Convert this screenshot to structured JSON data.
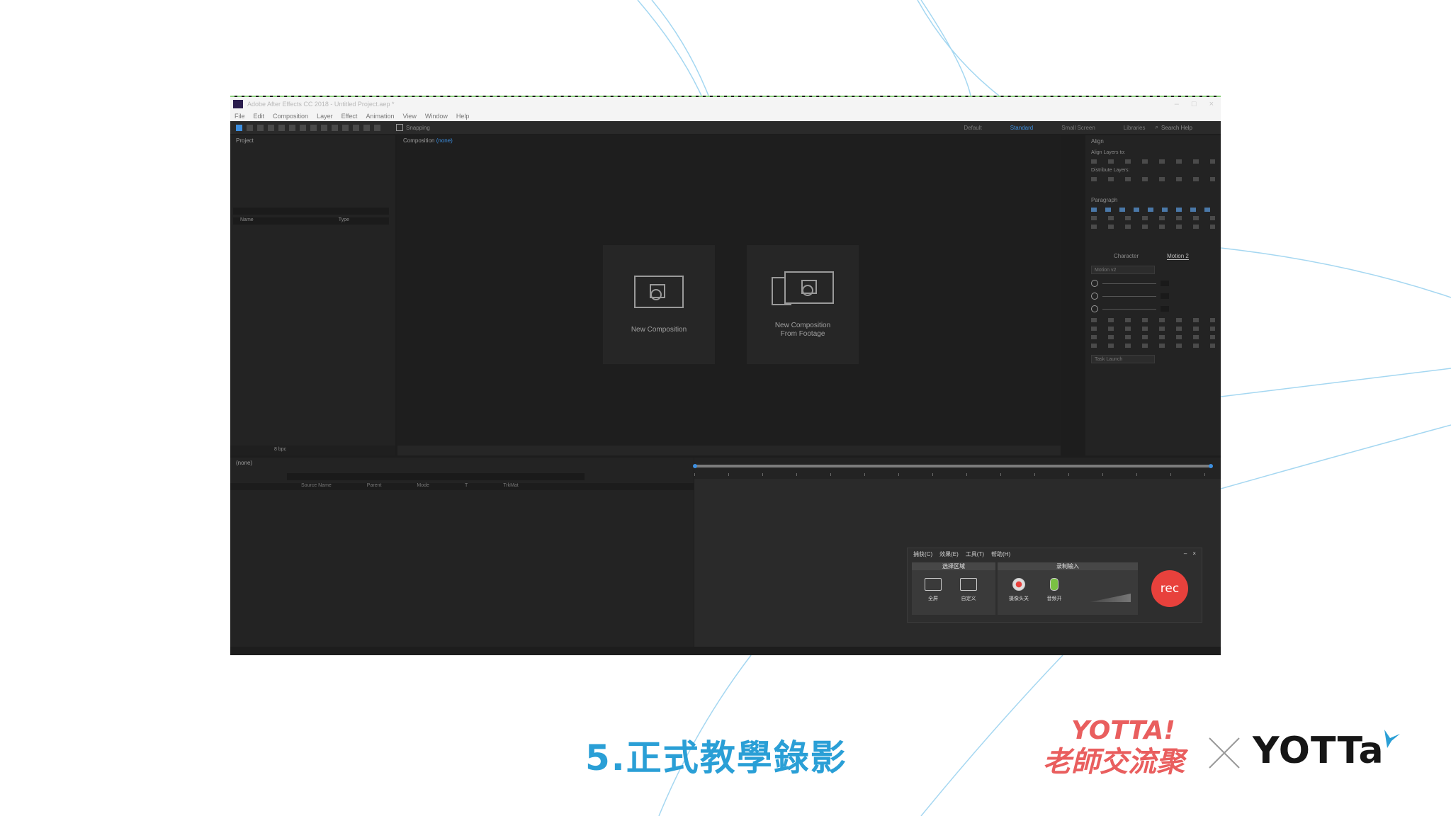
{
  "window": {
    "title": "Adobe After Effects CC 2018 - Untitled Project.aep *",
    "controls": [
      "–",
      "□",
      "×"
    ]
  },
  "menu": [
    "File",
    "Edit",
    "Composition",
    "Layer",
    "Effect",
    "Animation",
    "View",
    "Window",
    "Help"
  ],
  "toolbar": {
    "snapping_label": "Snapping",
    "workspaces": [
      "Default",
      "Standard",
      "Small Screen",
      "Libraries"
    ],
    "active_workspace": "Standard",
    "search_help": "Search Help"
  },
  "project_panel": {
    "title": "Project",
    "columns": [
      "Name",
      "Type"
    ],
    "bpc": "8 bpc"
  },
  "composition_panel": {
    "label": "Composition",
    "comp_name": "(none)",
    "cards": [
      {
        "label": "New Composition"
      },
      {
        "label": "New Composition From Footage"
      }
    ]
  },
  "right_panel": {
    "align_title": "Align",
    "align_layers_to": "Align Layers to:",
    "distribute_layers": "Distribute Layers:",
    "paragraph_title": "Paragraph",
    "character_tab": "Character",
    "motion_tab": "Motion 2",
    "motion_dropdown": "Motion v2",
    "task_launch": "Task Launch"
  },
  "timeline": {
    "comp_name": "(none)",
    "columns": [
      "Source Name",
      "Parent",
      "Mode",
      "T",
      "TrkMat"
    ]
  },
  "recorder": {
    "menu": [
      "捕获(C)",
      "效果(E)",
      "工具(T)",
      "帮助(H)"
    ],
    "group_area": "选择区域",
    "group_input": "录制输入",
    "items": [
      "全屏",
      "自定义",
      "摄像头关",
      "音频开"
    ],
    "rec_label": "rec",
    "rec_color": "#e8413c"
  },
  "footer": {
    "slide_title": "5.正式教學錄影",
    "brand_cn_line1": "YOTTA!",
    "brand_cn_line2": "老師交流聚",
    "brand_en": "YOTTa",
    "accent_color": "#2a9fd6"
  }
}
